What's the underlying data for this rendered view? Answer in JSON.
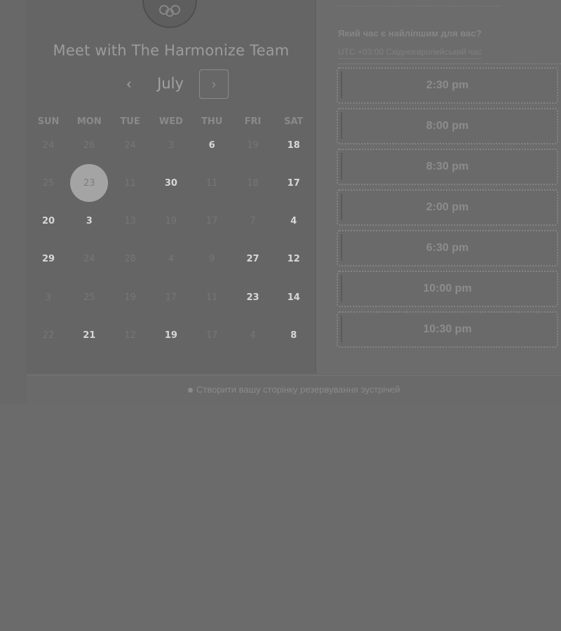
{
  "calendar": {
    "title": "Meet with The Harmonize Team",
    "month": "July",
    "prev_icon": "chevron-left-icon",
    "next_icon": "chevron-right-icon",
    "weekdays": [
      "SUN",
      "MON",
      "TUE",
      "WED",
      "THU",
      "FRI",
      "SAT"
    ],
    "weeks": [
      [
        {
          "d": "24",
          "a": false
        },
        {
          "d": "26",
          "a": false
        },
        {
          "d": "24",
          "a": false
        },
        {
          "d": "3",
          "a": false
        },
        {
          "d": "6",
          "a": true
        },
        {
          "d": "19",
          "a": false
        },
        {
          "d": "18",
          "a": true
        }
      ],
      [
        {
          "d": "25",
          "a": false
        },
        {
          "d": "23",
          "a": false,
          "selected": true
        },
        {
          "d": "11",
          "a": false
        },
        {
          "d": "30",
          "a": true
        },
        {
          "d": "11",
          "a": false
        },
        {
          "d": "18",
          "a": false
        },
        {
          "d": "17",
          "a": true
        }
      ],
      [
        {
          "d": "20",
          "a": true
        },
        {
          "d": "3",
          "a": true
        },
        {
          "d": "13",
          "a": false
        },
        {
          "d": "19",
          "a": false
        },
        {
          "d": "17",
          "a": false
        },
        {
          "d": "7",
          "a": false
        },
        {
          "d": "4",
          "a": true
        }
      ],
      [
        {
          "d": "29",
          "a": true
        },
        {
          "d": "24",
          "a": false
        },
        {
          "d": "28",
          "a": false
        },
        {
          "d": "4",
          "a": false
        },
        {
          "d": "9",
          "a": false
        },
        {
          "d": "27",
          "a": true
        },
        {
          "d": "12",
          "a": true
        }
      ],
      [
        {
          "d": "3",
          "a": false
        },
        {
          "d": "25",
          "a": false
        },
        {
          "d": "19",
          "a": false
        },
        {
          "d": "17",
          "a": false
        },
        {
          "d": "11",
          "a": false
        },
        {
          "d": "23",
          "a": true
        },
        {
          "d": "14",
          "a": true
        }
      ],
      [
        {
          "d": "22",
          "a": false
        },
        {
          "d": "21",
          "a": true
        },
        {
          "d": "12",
          "a": false
        },
        {
          "d": "19",
          "a": true
        },
        {
          "d": "17",
          "a": false
        },
        {
          "d": "4",
          "a": false
        },
        {
          "d": "8",
          "a": true
        }
      ]
    ]
  },
  "times": {
    "heading": "Який час є найліпшим для вас?",
    "timezone": "UTC +03:00 Східноєвропейський час",
    "slots": [
      "2:30 pm",
      "8:00 pm",
      "8:30 pm",
      "2:00 pm",
      "6:30 pm",
      "10:00 pm",
      "10:30 pm"
    ]
  },
  "footer": {
    "link": "Створити вашу сторінку резервування зустрічей"
  },
  "colors": {
    "background": "#6b6b6b",
    "panel": "#656565",
    "available_day": "#d7d7d7",
    "unavailable_day": "#767676",
    "selected_circle": "#a4a4a4"
  }
}
